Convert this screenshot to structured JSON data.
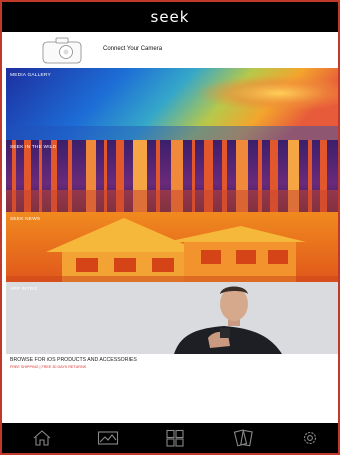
{
  "header": {
    "brand": "seek"
  },
  "connect": {
    "label": "Connect Your Camera",
    "icon": "camera-icon"
  },
  "tiles": [
    {
      "label": "MEDIA GALLERY"
    },
    {
      "label": "SEEK IN THE WILD"
    },
    {
      "label": "SEEK NEWS"
    },
    {
      "label": "APP INTRO"
    }
  ],
  "browse": {
    "title": "BROWSE FOR iOS PRODUCTS AND ACCESSORIES",
    "subtitle": "FREE SHIPPING | FREE 30 DAYS RETURNS"
  },
  "nav": {
    "items": [
      "home-icon",
      "gallery-icon",
      "grid-icon",
      "cards-icon",
      "settings-icon"
    ]
  },
  "colors": {
    "bar": "#000000",
    "accent": "#d8342e"
  }
}
